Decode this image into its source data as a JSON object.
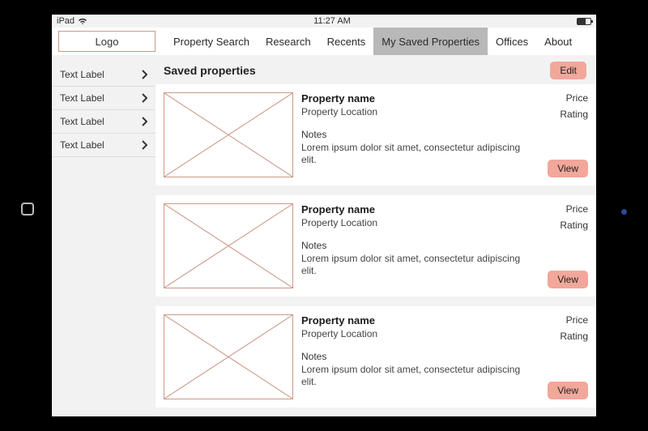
{
  "status": {
    "device": "iPad",
    "time": "11:27 AM"
  },
  "nav": {
    "logo": "Logo",
    "tabs": [
      {
        "label": "Property Search",
        "active": false
      },
      {
        "label": "Research",
        "active": false
      },
      {
        "label": "Recents",
        "active": false
      },
      {
        "label": "My Saved Properties",
        "active": true
      },
      {
        "label": "Offices",
        "active": false
      },
      {
        "label": "About",
        "active": false
      }
    ]
  },
  "sidebar": {
    "items": [
      {
        "label": "Text Label"
      },
      {
        "label": "Text Label"
      },
      {
        "label": "Text Label"
      },
      {
        "label": "Text Label"
      }
    ]
  },
  "content": {
    "title": "Saved properties",
    "edit_label": "Edit",
    "view_label": "View",
    "price_label": "Price",
    "rating_label": "Rating",
    "notes_label": "Notes",
    "properties": [
      {
        "name": "Property name",
        "location": "Property Location",
        "notes": "Lorem ipsum dolor sit amet, consectetur adipiscing elit."
      },
      {
        "name": "Property name",
        "location": "Property Location",
        "notes": "Lorem ipsum dolor sit amet, consectetur adipiscing elit."
      },
      {
        "name": "Property name",
        "location": "Property Location",
        "notes": "Lorem ipsum dolor sit amet, consectetur adipiscing elit."
      }
    ]
  }
}
